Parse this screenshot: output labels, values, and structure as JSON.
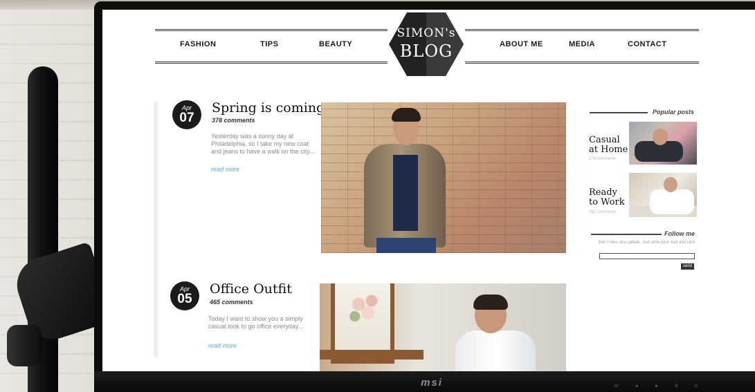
{
  "nav": {
    "left": [
      "FASHION",
      "TIPS",
      "BEAUTY"
    ],
    "right": [
      "ABOUT ME",
      "MEDIA",
      "CONTACT"
    ]
  },
  "logo": {
    "line1": "SIMON's",
    "line2": "BLOG"
  },
  "posts": [
    {
      "month": "Apr",
      "day": "07",
      "title": "Spring is coming!",
      "comments": "378 comments",
      "excerpt": "Yesterday was a sunny day at Philadelphia, so I take my new coat and jeans to have a walk on the city...",
      "read_more": "read more"
    },
    {
      "month": "Apr",
      "day": "05",
      "title": "Office Outfit",
      "comments": "465 comments",
      "excerpt": "Today I want to show you a simply casual look to go office everyday...",
      "read_more": "read more"
    }
  ],
  "sidebar": {
    "popular_heading": "Popular posts",
    "popular": [
      {
        "title_line1": "Casual",
        "title_line2": "at Home",
        "comments": "278 comments"
      },
      {
        "title_line1": "Ready",
        "title_line2": "to Work",
        "comments": "392 comments"
      }
    ],
    "follow_heading": "Follow me",
    "follow_text": "Don´t miss any update. Just write your mail and click.",
    "email_value": "",
    "send_label": "send"
  },
  "monitor": {
    "brand": "msi",
    "buttons": [
      "M",
      "◄",
      "►",
      "E",
      "⏻"
    ]
  },
  "colors": {
    "accent_link": "#5aa8d8",
    "badge": "#1b1b1b",
    "logo_hexagon": "#222222"
  }
}
